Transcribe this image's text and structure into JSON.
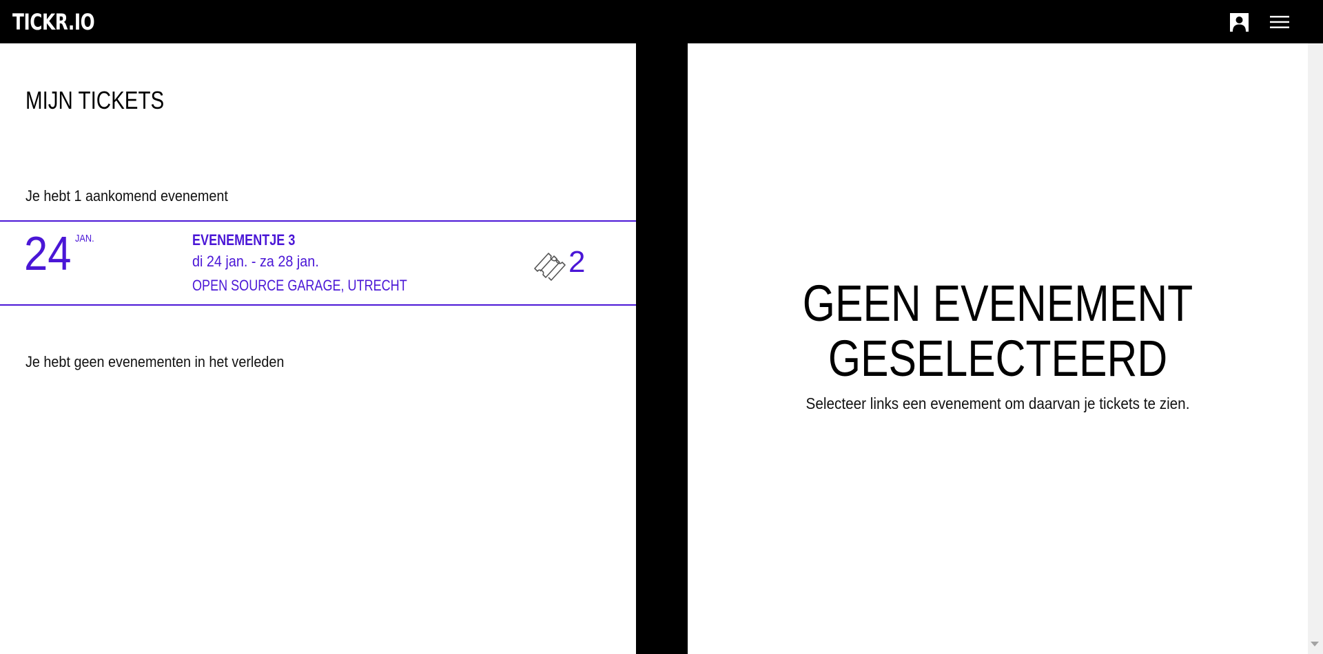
{
  "header": {
    "logo_text": "TICKR.IO",
    "account_icon": "user-icon",
    "menu_icon": "hamburger-menu-icon"
  },
  "left": {
    "title": "MIJN TICKETS",
    "upcoming_text": "Je hebt 1 aankomend evenement",
    "events": [
      {
        "day": "24",
        "month": "JAN.",
        "name": "EVENEMENTJE 3",
        "dates": "di 24 jan. - za 28 jan.",
        "location": "OPEN SOURCE GARAGE, UTRECHT",
        "ticket_icon": "ticket-icon",
        "ticket_count": "2"
      }
    ],
    "past_text": "Je hebt geen evenementen in het verleden"
  },
  "right": {
    "empty_title_line1": "GEEN EVENEMENT",
    "empty_title_line2": "GESELECTEERD",
    "empty_subtitle": "Selecteer links een evenement om daarvan je tickets te zien."
  },
  "colors": {
    "accent": "#4a16d6",
    "background": "#000000",
    "panel": "#ffffff"
  }
}
